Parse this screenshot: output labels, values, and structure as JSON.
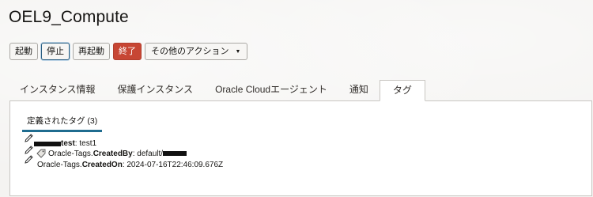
{
  "page": {
    "title": "OEL9_Compute"
  },
  "toolbar": {
    "start": "起動",
    "stop": "停止",
    "restart": "再起動",
    "terminate": "終了",
    "more_actions": "その他のアクション"
  },
  "tabs": [
    {
      "label": "インスタンス情報",
      "active": false
    },
    {
      "label": "保護インスタンス",
      "active": false
    },
    {
      "label": "Oracle Cloudエージェント",
      "active": false
    },
    {
      "label": "通知",
      "active": false
    },
    {
      "label": "タグ",
      "active": true
    }
  ],
  "panel": {
    "subtab_label": "定義されたタグ (3)",
    "tags": [
      {
        "key": "test",
        "separator": ": ",
        "value": "test1"
      },
      {
        "namespace": "Oracle-Tags.",
        "key": "CreatedBy",
        "separator": ": ",
        "value": "default/"
      },
      {
        "namespace": "Oracle-Tags.",
        "key": "CreatedOn",
        "separator": ": ",
        "value": "2024-07-16T22:46:09.676Z"
      }
    ]
  },
  "colors": {
    "terminate_bg": "#c74634",
    "accent_underline": "#1f6c8f",
    "stop_focus_border": "#2b5f82"
  },
  "icons": {
    "edit": "pencil-icon",
    "tag": "tag-icon",
    "dropdown": "chevron-down-icon"
  }
}
